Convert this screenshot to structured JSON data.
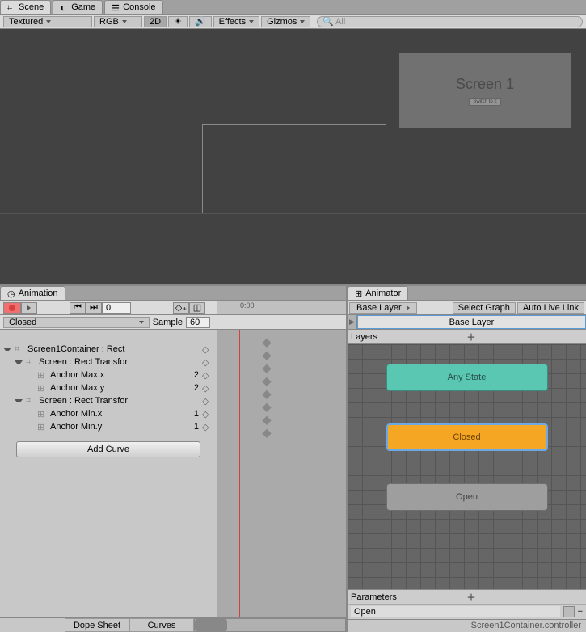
{
  "tabs": {
    "scene": "Scene",
    "game": "Game",
    "console": "Console"
  },
  "scene_toolbar": {
    "shading": "Textured",
    "render": "RGB",
    "mode2d": "2D",
    "effects": "Effects",
    "gizmos": "Gizmos",
    "search_placeholder": "All"
  },
  "scene_content": {
    "screen_title": "Screen 1",
    "screen_button": "Switch to 2"
  },
  "animation": {
    "tab": "Animation",
    "frame_field": "0",
    "clip": "Closed",
    "sample_label": "Sample",
    "sample_value": "60",
    "props": [
      {
        "name": "Screen1Container : Rect",
        "indent": 0,
        "arrow": "down",
        "val": ""
      },
      {
        "name": "Screen : Rect Transfor",
        "indent": 1,
        "arrow": "down",
        "val": ""
      },
      {
        "name": "Anchor Max.x",
        "indent": 2,
        "arrow": "",
        "val": "2"
      },
      {
        "name": "Anchor Max.y",
        "indent": 2,
        "arrow": "",
        "val": "2"
      },
      {
        "name": "Screen : Rect Transfor",
        "indent": 1,
        "arrow": "down",
        "val": ""
      },
      {
        "name": "Anchor Min.x",
        "indent": 2,
        "arrow": "",
        "val": "1"
      },
      {
        "name": "Anchor Min.y",
        "indent": 2,
        "arrow": "",
        "val": "1"
      }
    ],
    "add_curve": "Add Curve",
    "ruler_label": "0:00",
    "footer_dope": "Dope Sheet",
    "footer_curves": "Curves"
  },
  "animator": {
    "tab": "Animator",
    "breadcrumb": "Base Layer",
    "select_graph": "Select Graph",
    "auto_live": "Auto Live Link",
    "layer_name": "Base Layer",
    "layers_header": "Layers",
    "states": {
      "any": "Any State",
      "closed": "Closed",
      "open": "Open"
    },
    "params_header": "Parameters",
    "param_name": "Open",
    "status": "Screen1Container.controller"
  }
}
